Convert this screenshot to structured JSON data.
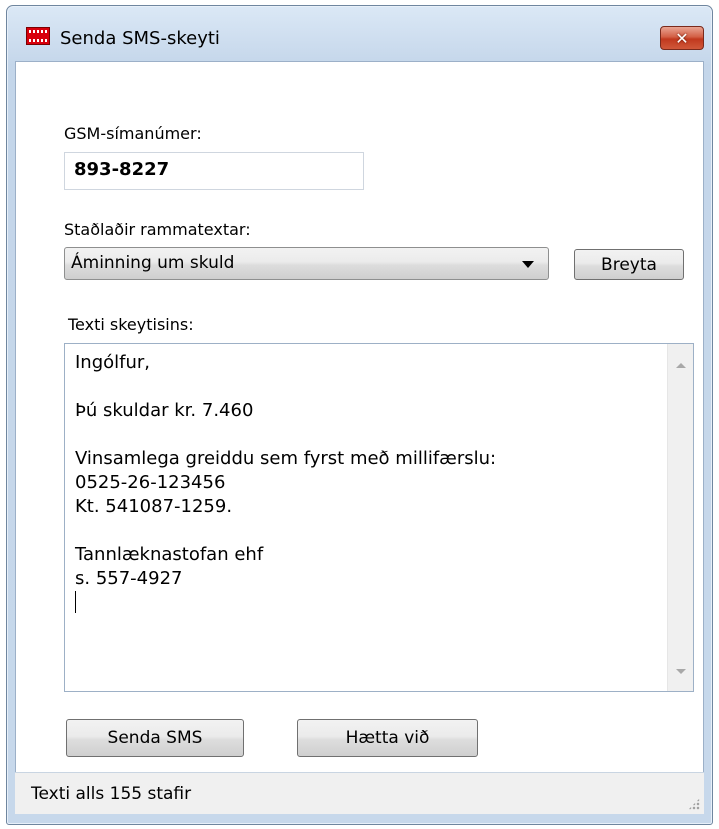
{
  "window": {
    "title": "Senda SMS-skeyti",
    "close_label": "✕"
  },
  "phone": {
    "label": "GSM-símanúmer:",
    "value": "893-8227"
  },
  "template": {
    "label": "Staðlaðir rammatextar:",
    "selected": "Áminning um skuld",
    "edit_button": "Breyta"
  },
  "message": {
    "label": "Texti skeytisins:",
    "lines": [
      "Ingólfur,",
      "",
      "Þú skuldar kr. 7.460",
      "",
      "Vinsamlega greiddu sem fyrst með millifærslu:",
      "0525-26-123456",
      "Kt. 541087-1259.",
      "",
      "Tannlæknastofan ehf",
      "s. 557-4927"
    ]
  },
  "buttons": {
    "send": "Senda SMS",
    "cancel": "Hætta við"
  },
  "status": {
    "text": "Texti alls 155 stafir"
  }
}
